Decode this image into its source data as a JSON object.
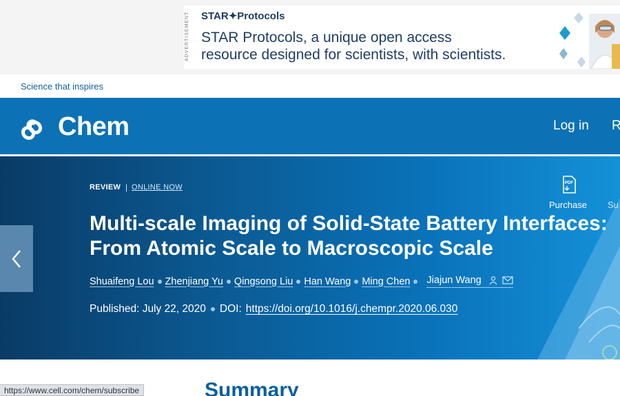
{
  "ad": {
    "tag": "ADVERTISEMENT",
    "brand": "STAR✦Protocols",
    "line1": "STAR Protocols, a unique open access",
    "line2": "resource designed for scientists, with scientists."
  },
  "tagline": "Science that inspires",
  "header": {
    "logo_text": "Chem",
    "login_label": "Log in",
    "register_label": "R"
  },
  "article": {
    "type": "REVIEW",
    "separator": "|",
    "status": "ONLINE NOW",
    "title_line1": "Multi-scale Imaging of Solid-State Battery Interfaces:",
    "title_line2": "From Atomic Scale to Macroscopic Scale",
    "authors": [
      "Shuaifeng Lou",
      "Zhenjiang Yu",
      "Qingsong Liu",
      "Han Wang",
      "Ming Chen",
      "Jiajun Wang"
    ],
    "published": "Published: July 22, 2020",
    "doi_label": "DOI:",
    "doi_url": "https://doi.org/10.1016/j.chempr.2020.06.030"
  },
  "actions": {
    "purchase_label": "Purchase",
    "subscribe_label": "Su"
  },
  "icons": {
    "prev": "chevron-left-icon",
    "purchase": "pdf-icon",
    "person": "person-icon",
    "mail": "mail-icon"
  },
  "colors": {
    "header_blue": "#0c72b5",
    "hero_dark": "#0a3b66",
    "link_blue": "#0f5f9a"
  },
  "main": {
    "section_heading": "Summary"
  },
  "status_bar": {
    "url": "https://www.cell.com/chem/subscribe"
  }
}
